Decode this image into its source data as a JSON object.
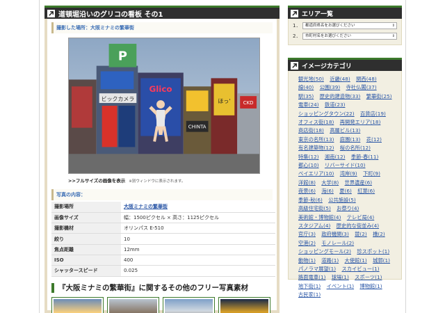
{
  "main": {
    "title": "道頓堀沿いのグリコの看板 その1",
    "location_heading": "撮影した場所：大阪ミナミの繁華街",
    "fullsize_link": ">>フルサイズの画像を表示",
    "fullsize_note": "※別ウィンドウに表示されます。",
    "contents_heading": "写真の内容：",
    "details": [
      {
        "key": "撮影場所",
        "value": "大阪ミナミの繁華街",
        "link": true
      },
      {
        "key": "画像サイズ",
        "value": "幅：1500ピクセル × 高さ：1125ピクセル",
        "link": false
      },
      {
        "key": "撮影機材",
        "value": "オリンパス E-510",
        "link": false
      },
      {
        "key": "絞り",
        "value": "10",
        "link": false
      },
      {
        "key": "焦点距離",
        "value": "12mm",
        "link": false
      },
      {
        "key": "ISO",
        "value": "400",
        "link": false
      },
      {
        "key": "シャッタースピード",
        "value": "0.025",
        "link": false
      }
    ],
    "related_title": "『大阪ミナミの繁華街』に関するその他のフリー写真素材",
    "photo_text": {
      "sign_top": "P",
      "sign_bic": "ビックカメラ",
      "sign_glico": "Glico",
      "sign_chinta": "CHINTA",
      "sign_waddy": "ほっ'",
      "sign_ckd": "CKD"
    }
  },
  "sidebar": {
    "area_title": "エリア一覧",
    "area_rows": [
      {
        "num": "1．",
        "placeholder": "都道府県名をお選びください"
      },
      {
        "num": "2．",
        "placeholder": "市町村名をお選びください"
      }
    ],
    "category_title": "イメージカテゴリ",
    "categories": [
      "観光地(50)",
      "近畿(48)",
      "関西(48)",
      "線(40)",
      "公園(39)",
      "寺社仏閣(37)",
      "駅(35)",
      "歴史的建造物(33)",
      "繁華街(25)",
      "電車(24)",
      "鉄道(23)",
      "ショッピングタウン(22)",
      "百貨店(19)",
      "オフィス街(18)",
      "再開発エリア(18)",
      "商店街(18)",
      "高層ビル(13)",
      "東京の名所(13)",
      "庭園(13)",
      "花(12)",
      "有名建築物(12)",
      "桜の名所(12)",
      "特集(12)",
      "湘南(12)",
      "季節-春(11)",
      "都心(10)",
      "リバーサイド(10)",
      "ベイエリア(10)",
      "湾岸(9)",
      "下町(9)",
      "洋館(8)",
      "大学(8)",
      "世界遺産(6)",
      "夜景(6)",
      "海(6)",
      "夏(6)",
      "紅葉(6)",
      "季節-秋(6)",
      "公共施設(5)",
      "高級住宅街(5)",
      "お祭り(4)",
      "美術館・博物館(4)",
      "テレビ局(4)",
      "スタジアム(4)",
      "歴史的な街並み(4)",
      "官庁(3)",
      "政府機関(3)",
      "競(2)",
      "橋(2)",
      "空港(2)",
      "モノレール(2)",
      "ショッピングモール(2)",
      "珍スポット(1)",
      "動物(1)",
      "道路(1)",
      "大使館(1)",
      "城郭(1)",
      "パノラマ展望(1)",
      "スカイビュー(1)",
      "路面電車(1)",
      "球場(1)",
      "スポーツ(1)",
      "地下街(1)",
      "イベント(1)",
      "博物館(1)",
      "古民家(1)"
    ]
  },
  "colors": {
    "accent_green": "#3d7a2c",
    "header_dark": "#2f2f2f",
    "link_blue": "#2a56a6",
    "panel_beige": "#f2efe2"
  },
  "icons": {
    "header_arrow": "arrow-up-right-icon"
  }
}
